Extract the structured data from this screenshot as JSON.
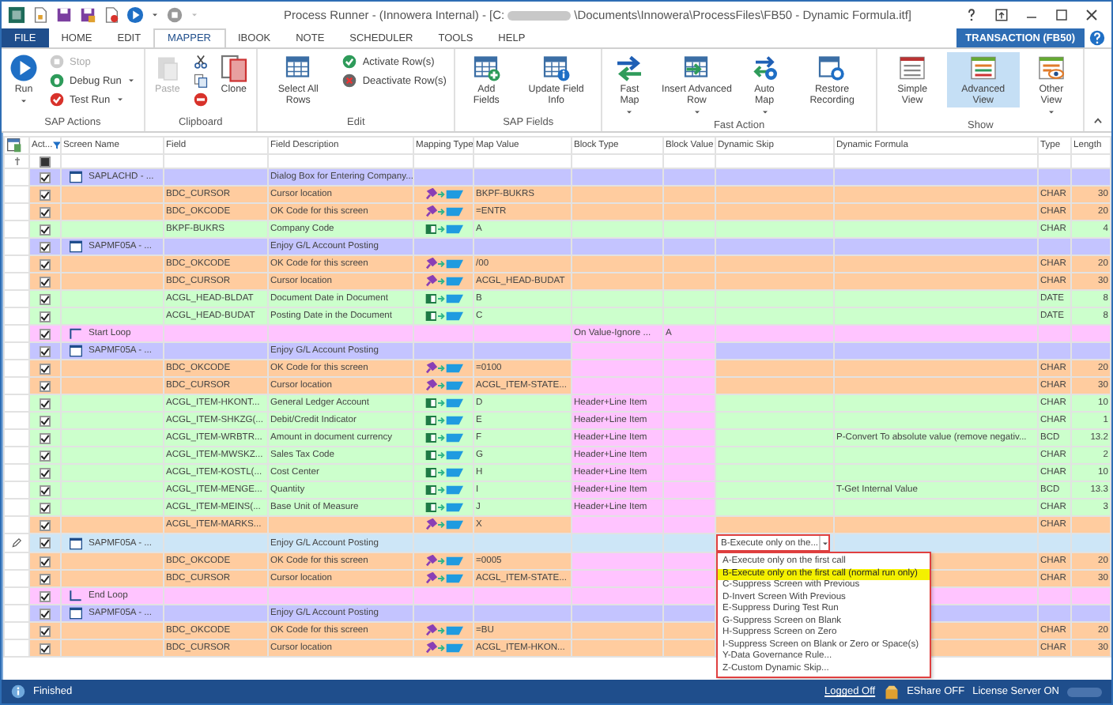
{
  "window": {
    "title_start": "Process Runner - (Innowera Internal) - [C:",
    "title_end": "\\Documents\\Innowera\\ProcessFiles\\FB50 - Dynamic Formula.itf]"
  },
  "tabs": [
    {
      "label": "FILE",
      "kind": "file",
      "selected": false
    },
    {
      "label": "HOME",
      "kind": "tab",
      "selected": false
    },
    {
      "label": "EDIT",
      "kind": "tab",
      "selected": false
    },
    {
      "label": "MAPPER",
      "kind": "tab",
      "selected": true
    },
    {
      "label": "IBOOK",
      "kind": "tab",
      "selected": false
    },
    {
      "label": "NOTE",
      "kind": "tab",
      "selected": false
    },
    {
      "label": "SCHEDULER",
      "kind": "tab",
      "selected": false
    },
    {
      "label": "TOOLS",
      "kind": "tab",
      "selected": false
    },
    {
      "label": "HELP",
      "kind": "tab",
      "selected": false
    }
  ],
  "transaction_badge": "TRANSACTION (FB50)",
  "ribbon": {
    "groups": [
      {
        "label": "SAP Actions",
        "items": [
          {
            "kind": "large",
            "label": "Run",
            "menu": true,
            "disabled": false
          },
          {
            "kind": "small",
            "label": "Stop",
            "menu": false,
            "disabled": true
          },
          {
            "kind": "small",
            "label": "Debug Run",
            "menu": true,
            "disabled": false
          },
          {
            "kind": "small",
            "label": "Test Run",
            "menu": true,
            "disabled": false
          }
        ]
      },
      {
        "label": "Clipboard",
        "items": [
          {
            "kind": "large",
            "label": "Paste",
            "menu": false,
            "disabled": true
          },
          {
            "kind": "small",
            "menu": false,
            "disabled": false
          },
          {
            "kind": "small",
            "menu": false,
            "disabled": false
          },
          {
            "kind": "small",
            "menu": false,
            "disabled": false
          },
          {
            "kind": "large",
            "label": "Clone",
            "menu": false,
            "disabled": false
          }
        ]
      },
      {
        "label": "Edit",
        "items": [
          {
            "kind": "large",
            "label": "Select All Rows",
            "menu": false,
            "disabled": false
          },
          {
            "kind": "small",
            "label": "Activate Row(s)",
            "menu": false,
            "disabled": false
          },
          {
            "kind": "small",
            "label": "Deactivate Row(s)",
            "menu": false,
            "disabled": false
          }
        ]
      },
      {
        "label": "SAP Fields",
        "items": [
          {
            "kind": "large",
            "label": "Add Fields",
            "menu": false,
            "disabled": false
          },
          {
            "kind": "large",
            "label": "Update Field Info",
            "menu": false,
            "disabled": false
          }
        ]
      },
      {
        "label": "Fast Action",
        "items": [
          {
            "kind": "large",
            "label": "Fast Map",
            "menu": true,
            "disabled": false
          },
          {
            "kind": "large",
            "label": "Insert Advanced Row",
            "menu": true,
            "disabled": false
          },
          {
            "kind": "large",
            "label": "Auto Map",
            "menu": true,
            "disabled": false
          },
          {
            "kind": "large",
            "label": "Restore Recording",
            "menu": false,
            "disabled": false
          }
        ]
      },
      {
        "label": "Show",
        "items": [
          {
            "kind": "large",
            "label": "Simple View",
            "menu": false,
            "disabled": false,
            "selected": false
          },
          {
            "kind": "large",
            "label": "Advanced View",
            "menu": false,
            "disabled": false,
            "selected": true
          },
          {
            "kind": "large",
            "label": "Other View",
            "menu": true,
            "disabled": false,
            "selected": false
          }
        ]
      }
    ]
  },
  "grid": {
    "filter_row": {
      "active_checked": true
    },
    "columns": [
      "Act...",
      "Screen Name",
      "Field",
      "Field Description",
      "Mapping Type",
      "Map Value",
      "Block Type",
      "Block Value",
      "Dynamic Skip",
      "Dynamic Formula",
      "Type",
      "Length"
    ],
    "rows": [
      {
        "kind": "screen",
        "active": true,
        "selected": false,
        "in_loop": false,
        "screen": "SAPLACHD - ...",
        "description": "Dialog Box for Entering Company..."
      },
      {
        "kind": "bdc",
        "active": true,
        "selected": false,
        "in_loop": false,
        "field": "BDC_CURSOR",
        "description": "Cursor location",
        "map_value": "BKPF-BUKRS",
        "type": "CHAR",
        "length": "30"
      },
      {
        "kind": "bdc",
        "active": true,
        "selected": false,
        "in_loop": false,
        "field": "BDC_OKCODE",
        "description": "OK Code for this screen",
        "map_value": "=ENTR",
        "type": "CHAR",
        "length": "20"
      },
      {
        "kind": "field",
        "active": true,
        "selected": false,
        "in_loop": false,
        "field": "BKPF-BUKRS",
        "description": "Company Code",
        "map_value": "A",
        "type": "CHAR",
        "length": "4"
      },
      {
        "kind": "screen",
        "active": true,
        "selected": false,
        "in_loop": false,
        "screen": "SAPMF05A - ...",
        "description": "Enjoy G/L Account Posting"
      },
      {
        "kind": "bdc",
        "active": true,
        "selected": false,
        "in_loop": false,
        "field": "BDC_OKCODE",
        "description": "OK Code for this screen",
        "map_value": "/00",
        "type": "CHAR",
        "length": "20"
      },
      {
        "kind": "bdc",
        "active": true,
        "selected": false,
        "in_loop": false,
        "field": "BDC_CURSOR",
        "description": "Cursor location",
        "map_value": "ACGL_HEAD-BUDAT",
        "type": "CHAR",
        "length": "30"
      },
      {
        "kind": "field",
        "active": true,
        "selected": false,
        "in_loop": false,
        "field": "ACGL_HEAD-BLDAT",
        "description": "Document Date in Document",
        "map_value": "B",
        "type": "DATE",
        "length": "8"
      },
      {
        "kind": "field",
        "active": true,
        "selected": false,
        "in_loop": false,
        "field": "ACGL_HEAD-BUDAT",
        "description": "Posting Date in the Document",
        "map_value": "C",
        "type": "DATE",
        "length": "8"
      },
      {
        "kind": "loop_start",
        "active": true,
        "selected": false,
        "in_loop": false,
        "screen": "Start Loop",
        "block_type": "On Value-Ignore ...",
        "block_value": "A"
      },
      {
        "kind": "screen",
        "active": true,
        "selected": false,
        "in_loop": true,
        "screen": "SAPMF05A - ...",
        "description": "Enjoy G/L Account Posting"
      },
      {
        "kind": "bdc",
        "active": true,
        "selected": false,
        "in_loop": true,
        "field": "BDC_OKCODE",
        "description": "OK Code for this screen",
        "map_value": "=0100",
        "type": "CHAR",
        "length": "20"
      },
      {
        "kind": "bdc",
        "active": true,
        "selected": false,
        "in_loop": true,
        "field": "BDC_CURSOR",
        "description": "Cursor location",
        "map_value": "ACGL_ITEM-STATE...",
        "type": "CHAR",
        "length": "30"
      },
      {
        "kind": "field",
        "active": true,
        "selected": false,
        "in_loop": true,
        "field": "ACGL_ITEM-HKONT...",
        "description": "General Ledger Account",
        "map_value": "D",
        "block_type": "Header+Line Item",
        "type": "CHAR",
        "length": "10"
      },
      {
        "kind": "field",
        "active": true,
        "selected": false,
        "in_loop": true,
        "field": "ACGL_ITEM-SHKZG(...",
        "description": "Debit/Credit Indicator",
        "map_value": "E",
        "block_type": "Header+Line Item",
        "type": "CHAR",
        "length": "1"
      },
      {
        "kind": "field",
        "active": true,
        "selected": false,
        "in_loop": true,
        "field": "ACGL_ITEM-WRBTR...",
        "description": "Amount in document currency",
        "map_value": "F",
        "block_type": "Header+Line Item",
        "dynamic_formula": "P-Convert To absolute value (remove negativ...",
        "type": "BCD",
        "length": "13.2"
      },
      {
        "kind": "field",
        "active": true,
        "selected": false,
        "in_loop": true,
        "field": "ACGL_ITEM-MWSKZ...",
        "description": "Sales Tax Code",
        "map_value": "G",
        "block_type": "Header+Line Item",
        "type": "CHAR",
        "length": "2"
      },
      {
        "kind": "field",
        "active": true,
        "selected": false,
        "in_loop": true,
        "field": "ACGL_ITEM-KOSTL(...",
        "description": "Cost Center",
        "map_value": "H",
        "block_type": "Header+Line Item",
        "type": "CHAR",
        "length": "10"
      },
      {
        "kind": "field",
        "active": true,
        "selected": false,
        "in_loop": true,
        "field": "ACGL_ITEM-MENGE...",
        "description": "Quantity",
        "map_value": "I",
        "block_type": "Header+Line Item",
        "dynamic_formula": "T-Get Internal Value",
        "type": "BCD",
        "length": "13.3"
      },
      {
        "kind": "field",
        "active": true,
        "selected": false,
        "in_loop": true,
        "field": "ACGL_ITEM-MEINS(...",
        "description": "Base Unit of Measure",
        "map_value": "J",
        "block_type": "Header+Line Item",
        "type": "CHAR",
        "length": "3"
      },
      {
        "kind": "bdc",
        "active": true,
        "selected": false,
        "in_loop": true,
        "field": "ACGL_ITEM-MARKS...",
        "map_value": "X",
        "type": "CHAR"
      },
      {
        "kind": "screen",
        "active": true,
        "selected": true,
        "in_loop": true,
        "screen": "SAPMF05A - ...",
        "description": "Enjoy G/L Account Posting",
        "dynamic_skip": {
          "value": "B-Execute only on the...",
          "open": true,
          "options": [
            {
              "label": "A-Execute only on the first call",
              "selected": false
            },
            {
              "label": "B-Execute only on the first call (normal run only)",
              "selected": true
            },
            {
              "label": "C-Suppress Screen with Previous",
              "selected": false
            },
            {
              "label": "D-Invert Screen With Previous",
              "selected": false
            },
            {
              "label": "E-Suppress During Test Run",
              "selected": false
            },
            {
              "label": "G-Suppress Screen on Blank",
              "selected": false
            },
            {
              "label": "H-Suppress Screen on Zero",
              "selected": false
            },
            {
              "label": "I-Suppress Screen on Blank or Zero or Space(s)",
              "selected": false
            },
            {
              "label": "Y-Data Governance Rule...",
              "selected": false
            },
            {
              "label": "Z-Custom Dynamic Skip...",
              "selected": false
            }
          ]
        }
      },
      {
        "kind": "bdc",
        "active": true,
        "selected": false,
        "in_loop": true,
        "field": "BDC_OKCODE",
        "description": "OK Code for this screen",
        "map_value": "=0005",
        "type": "CHAR",
        "length": "20"
      },
      {
        "kind": "bdc",
        "active": true,
        "selected": false,
        "in_loop": true,
        "field": "BDC_CURSOR",
        "description": "Cursor location",
        "map_value": "ACGL_ITEM-STATE...",
        "type": "CHAR",
        "length": "30"
      },
      {
        "kind": "loop_end",
        "active": true,
        "selected": false,
        "in_loop": false,
        "screen": "End Loop"
      },
      {
        "kind": "screen",
        "active": true,
        "selected": false,
        "in_loop": false,
        "screen": "SAPMF05A - ...",
        "description": "Enjoy G/L Account Posting"
      },
      {
        "kind": "bdc",
        "active": true,
        "selected": false,
        "in_loop": false,
        "field": "BDC_OKCODE",
        "description": "OK Code for this screen",
        "map_value": "=BU",
        "type": "CHAR",
        "length": "20"
      },
      {
        "kind": "bdc",
        "active": true,
        "selected": false,
        "in_loop": false,
        "field": "BDC_CURSOR",
        "description": "Cursor location",
        "map_value": "ACGL_ITEM-HKON...",
        "type": "CHAR",
        "length": "30"
      }
    ]
  },
  "status_bar": {
    "message": "Finished",
    "login": "Logged Off",
    "eshare": "EShare OFF",
    "license": "License Server ON"
  }
}
